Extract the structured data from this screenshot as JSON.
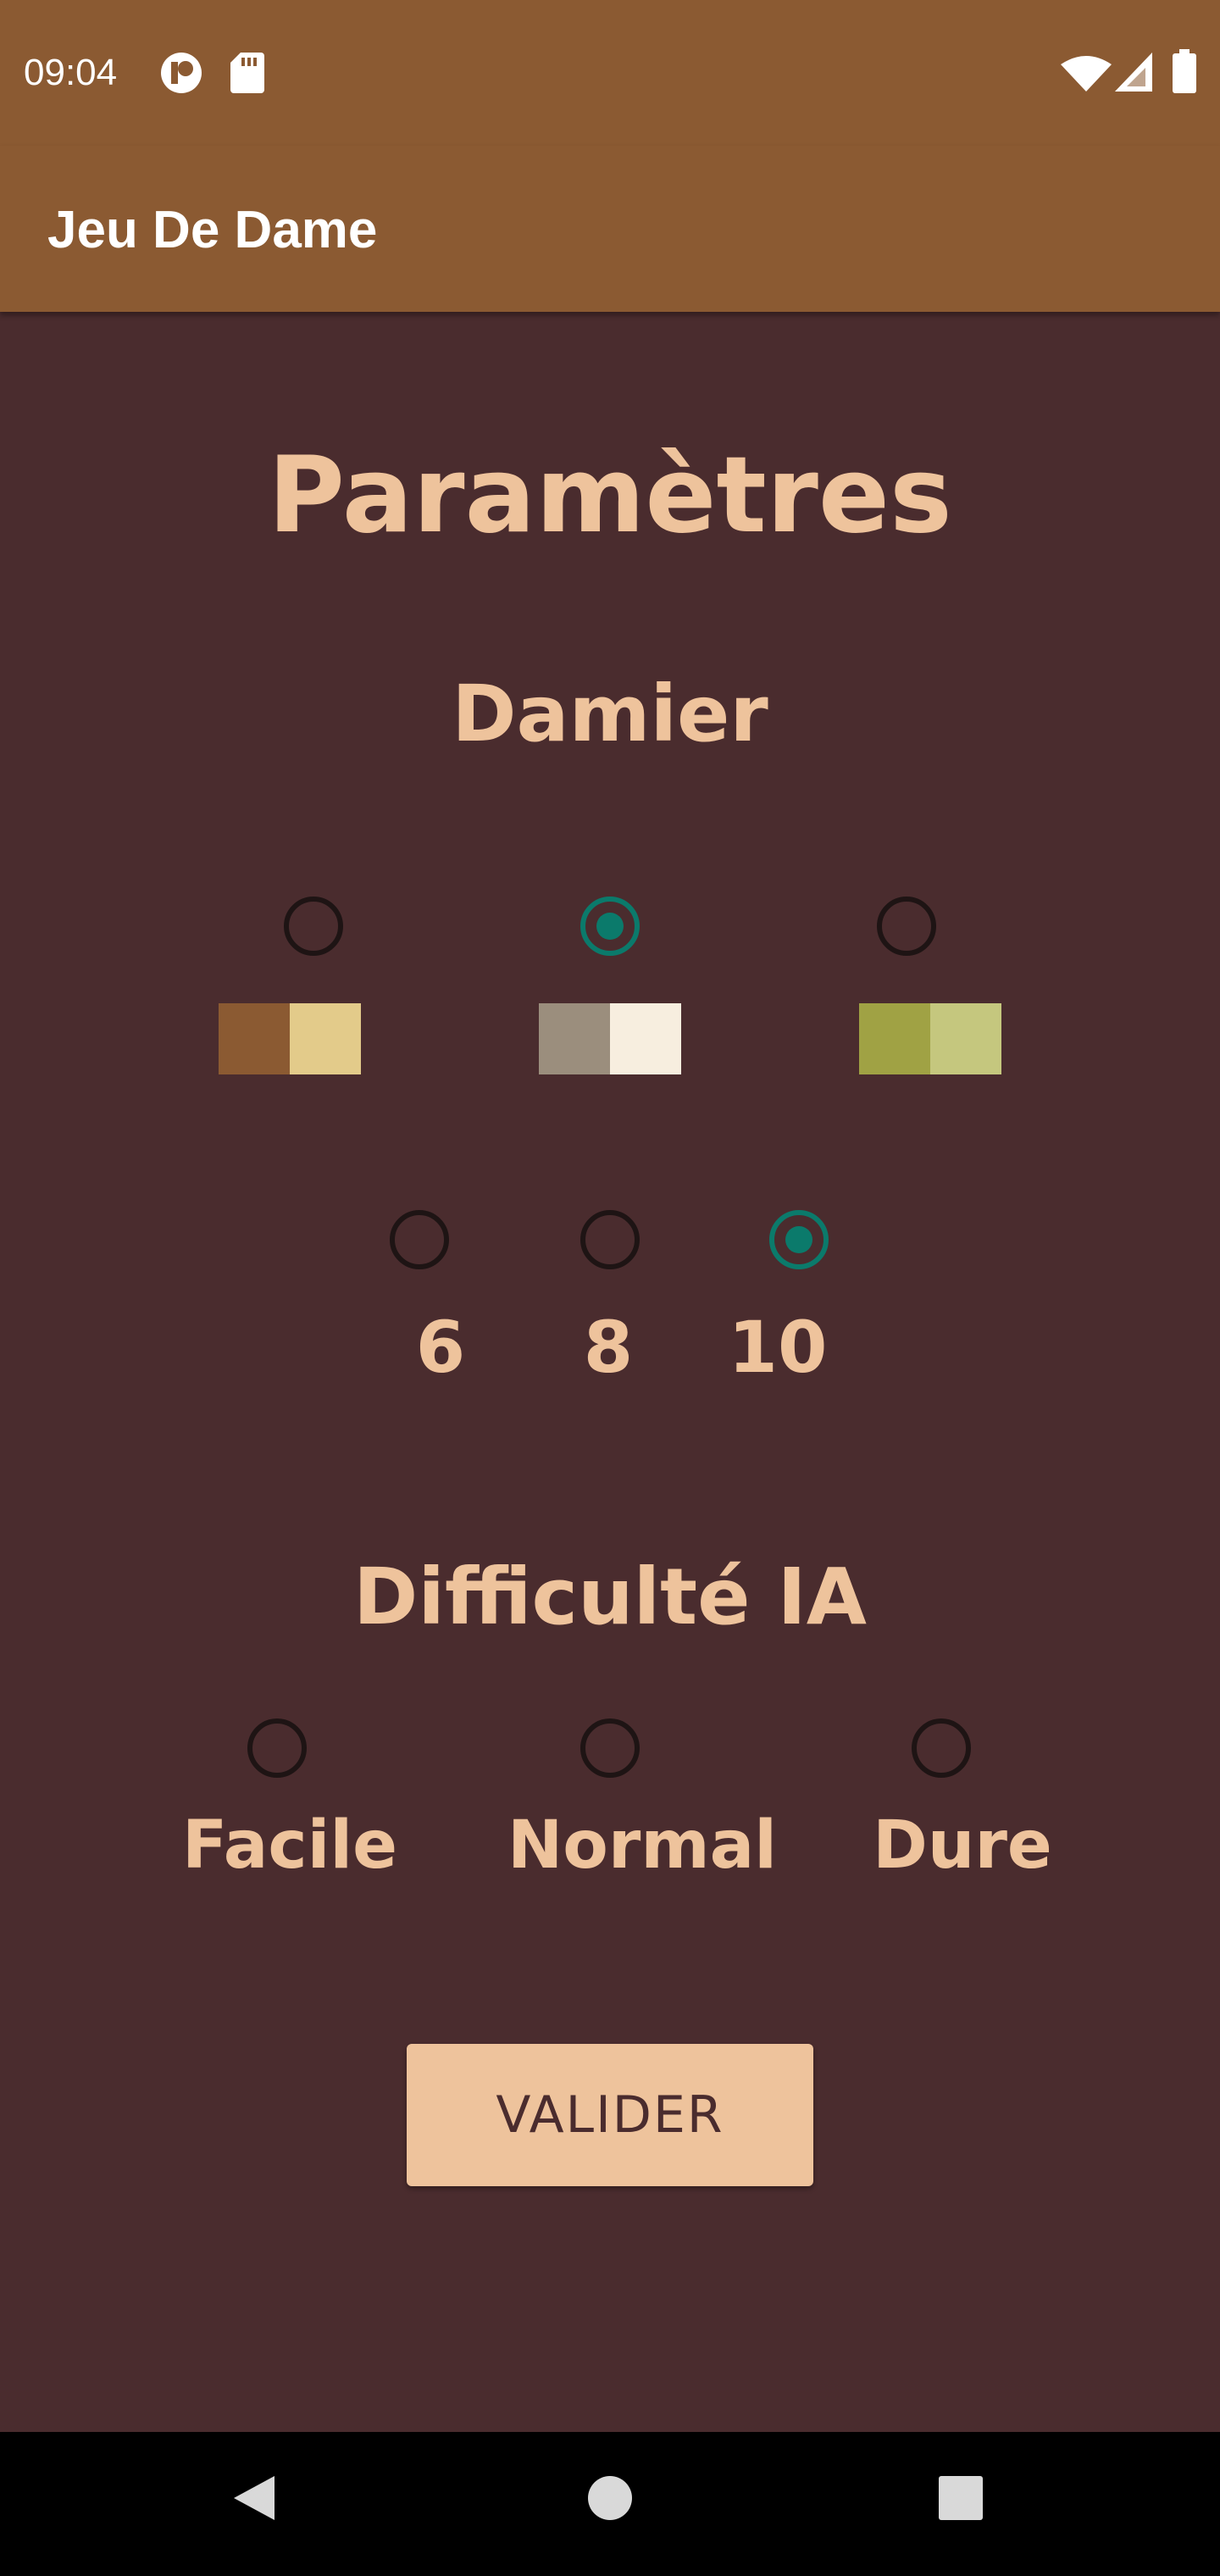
{
  "status_bar": {
    "time": "09:04",
    "left_icons": [
      "data-saver-icon",
      "sd-card-icon"
    ],
    "right_icons": [
      "wifi-icon",
      "cell-signal-icon",
      "battery-icon"
    ]
  },
  "app_bar": {
    "title": "Jeu De Dame"
  },
  "page": {
    "title": "Paramètres"
  },
  "board": {
    "title": "Damier",
    "color_options": [
      {
        "dark": "#8B5A32",
        "light": "#E3CB8A",
        "selected": false
      },
      {
        "dark": "#9B8E7D",
        "light": "#F7EEDF",
        "selected": true
      },
      {
        "dark": "#A0A244",
        "light": "#C5C77E",
        "selected": false
      }
    ],
    "size_options": [
      {
        "label": "6",
        "selected": false
      },
      {
        "label": "8",
        "selected": false
      },
      {
        "label": "10",
        "selected": true
      }
    ]
  },
  "difficulty": {
    "title": "Difficulté IA",
    "options": [
      {
        "label": "Facile",
        "selected": false
      },
      {
        "label": "Normal",
        "selected": false
      },
      {
        "label": "Dure",
        "selected": false
      }
    ]
  },
  "actions": {
    "validate_label": "VALIDER"
  },
  "nav_bar": {
    "buttons": [
      "back-icon",
      "home-icon",
      "recents-icon"
    ]
  },
  "colors": {
    "primary": "#8B5A32",
    "background": "#4A2C2E",
    "accent_text": "#EEC39C",
    "radio_checked": "#0B7A6B"
  }
}
